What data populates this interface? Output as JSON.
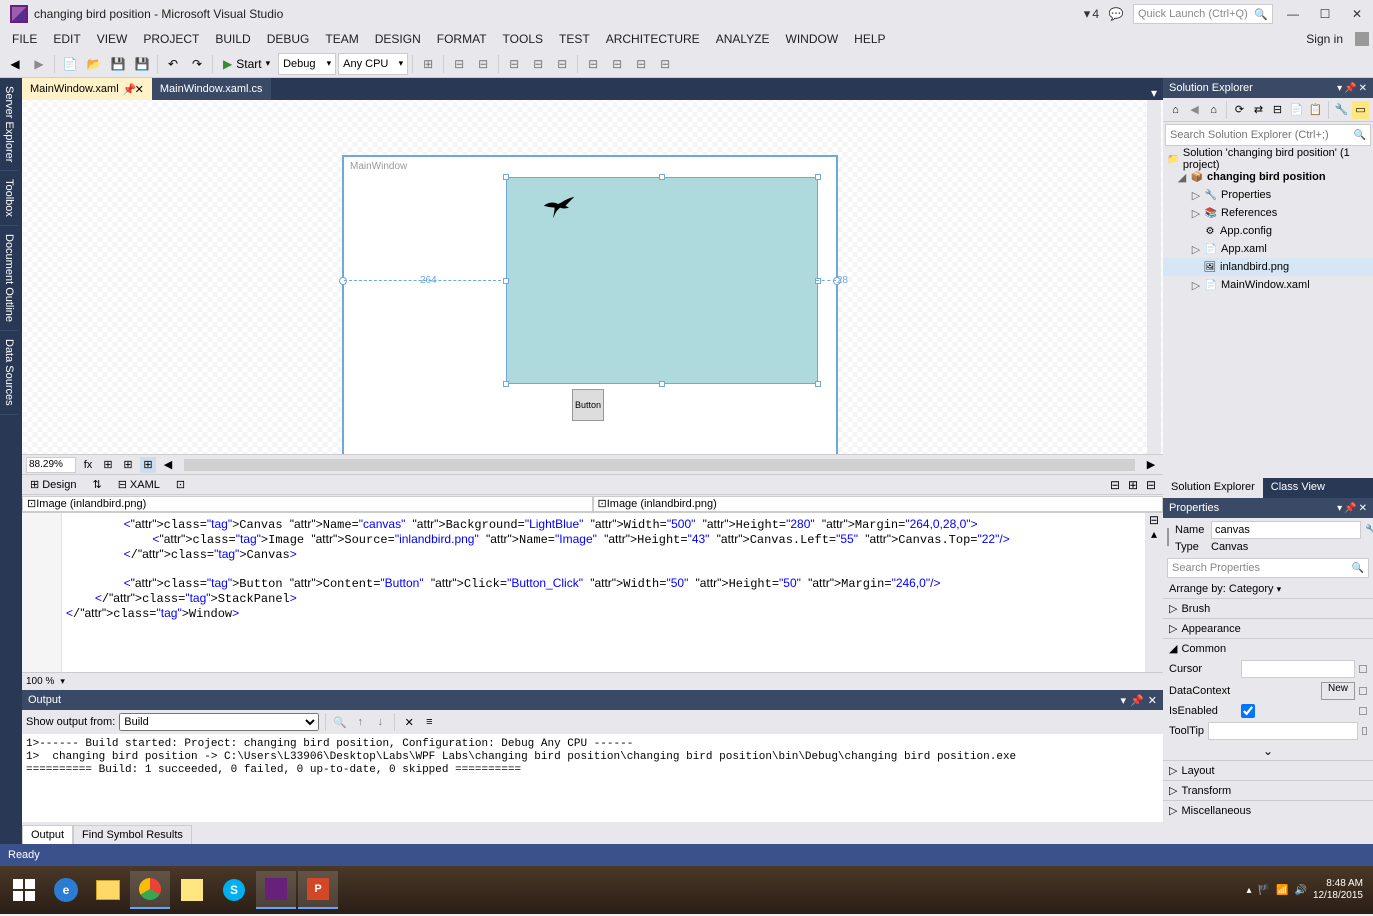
{
  "titlebar": {
    "title": "changing bird position - Microsoft Visual Studio",
    "notifications": "4",
    "quick_launch_placeholder": "Quick Launch (Ctrl+Q)"
  },
  "menubar": {
    "items": [
      "FILE",
      "EDIT",
      "VIEW",
      "PROJECT",
      "BUILD",
      "DEBUG",
      "TEAM",
      "DESIGN",
      "FORMAT",
      "TOOLS",
      "TEST",
      "ARCHITECTURE",
      "ANALYZE",
      "WINDOW",
      "HELP"
    ],
    "signin": "Sign in"
  },
  "toolbar": {
    "start": "Start",
    "config": "Debug",
    "platform": "Any CPU"
  },
  "doc_tabs": [
    {
      "label": "MainWindow.xaml",
      "active": true
    },
    {
      "label": "MainWindow.xaml.cs",
      "active": false
    }
  ],
  "left_tabs": [
    "Server Explorer",
    "Toolbox",
    "Document Outline",
    "Data Sources"
  ],
  "designer": {
    "window_title": "MainWindow",
    "margin_left": "264",
    "margin_right": "28",
    "button_label": "Button",
    "zoom": "88.29%",
    "design_tab": "Design",
    "xaml_tab": "XAML",
    "breadcrumb_left": "Image (inlandbird.png)",
    "breadcrumb_right": "Image (inlandbird.png)"
  },
  "xaml_code_lines": [
    "        <Canvas Name=\"canvas\" Background=\"LightBlue\" Width=\"500\" Height=\"280\" Margin=\"264,0,28,0\">",
    "            <Image Source=\"inlandbird.png\" Name=\"Image\" Height=\"43\" Canvas.Left=\"55\" Canvas.Top=\"22\"/>",
    "        </Canvas>",
    "",
    "        <Button Content=\"Button\" Click=\"Button_Click\" Width=\"50\" Height=\"50\" Margin=\"246,0\"/>",
    "    </StackPanel>",
    "</Window>"
  ],
  "xaml_zoom": "100 %",
  "output": {
    "title": "Output",
    "show_label": "Show output from:",
    "show_value": "Build",
    "lines": [
      "1>------ Build started: Project: changing bird position, Configuration: Debug Any CPU ------",
      "1>  changing bird position -> C:\\Users\\L33906\\Desktop\\Labs\\WPF Labs\\changing bird position\\changing bird position\\bin\\Debug\\changing bird position.exe",
      "========== Build: 1 succeeded, 0 failed, 0 up-to-date, 0 skipped =========="
    ],
    "tabs": [
      "Output",
      "Find Symbol Results"
    ]
  },
  "solution_explorer": {
    "title": "Solution Explorer",
    "search_placeholder": "Search Solution Explorer (Ctrl+;)",
    "root": "Solution 'changing bird position' (1 project)",
    "project": "changing bird position",
    "nodes": [
      "Properties",
      "References",
      "App.config",
      "App.xaml",
      "inlandbird.png",
      "MainWindow.xaml"
    ],
    "tabs": [
      "Solution Explorer",
      "Class View"
    ]
  },
  "properties": {
    "title": "Properties",
    "name_label": "Name",
    "name_value": "canvas",
    "type_label": "Type",
    "type_value": "Canvas",
    "search_placeholder": "Search Properties",
    "arrange": "Arrange by: Category",
    "categories": [
      "Brush",
      "Appearance",
      "Common",
      "Layout",
      "Transform",
      "Miscellaneous"
    ],
    "common": {
      "cursor_label": "Cursor",
      "datacontext_label": "DataContext",
      "datacontext_btn": "New",
      "isenabled_label": "IsEnabled",
      "isenabled_value": true,
      "tooltip_label": "ToolTip"
    }
  },
  "statusbar": {
    "text": "Ready"
  },
  "taskbar": {
    "time": "8:48 AM",
    "date": "12/18/2015"
  }
}
